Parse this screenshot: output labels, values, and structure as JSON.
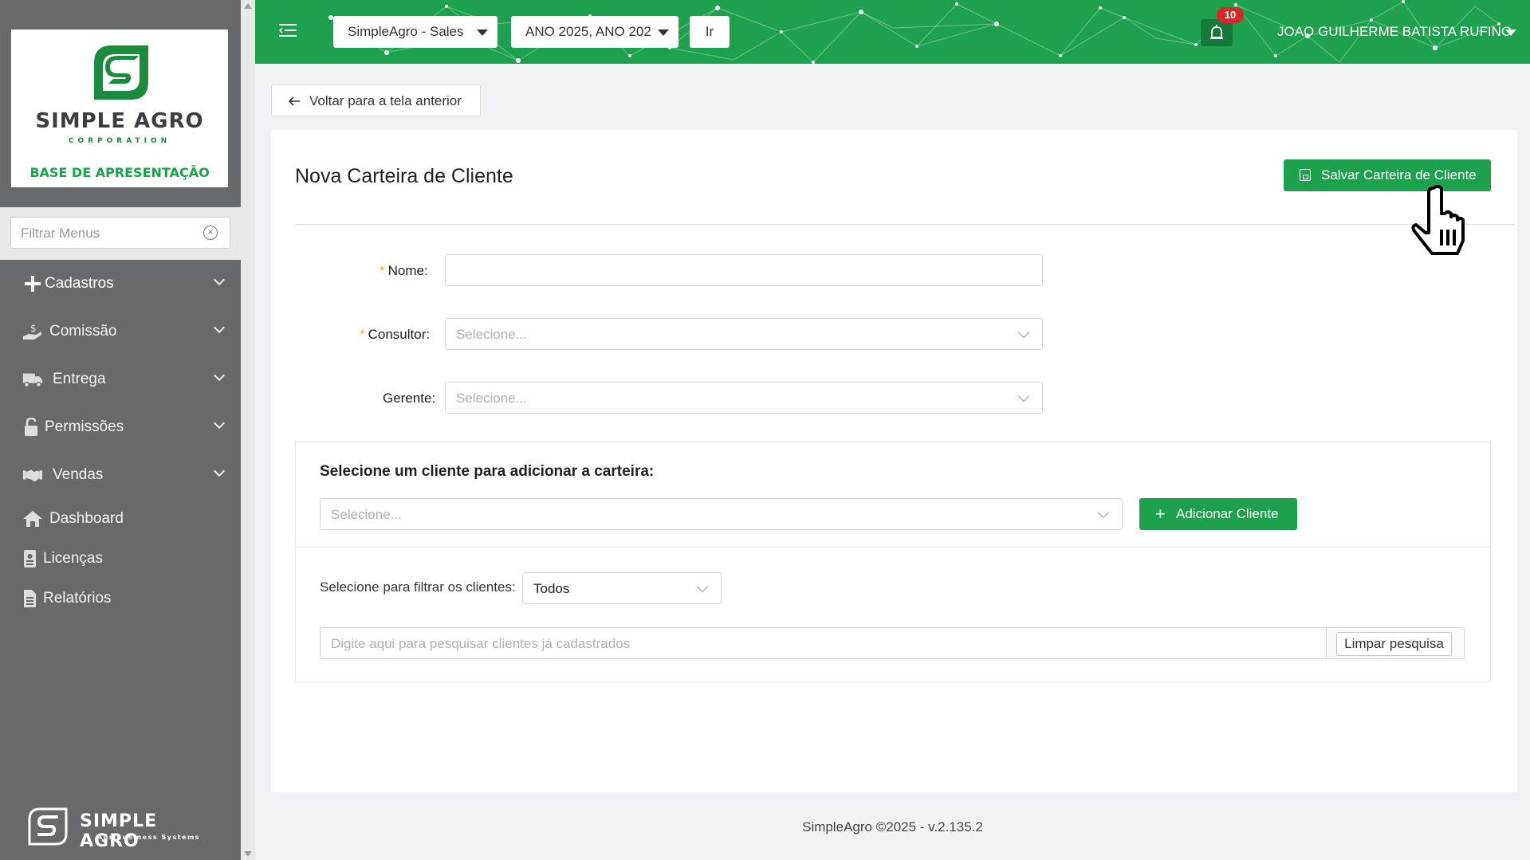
{
  "sidebar": {
    "logo": {
      "title": "SIMPLE AGRO",
      "subtitle": "CORPORATION",
      "base": "BASE DE APRESENTAÇÃO"
    },
    "filter_placeholder": "Filtrar Menus",
    "items": [
      {
        "label": "Cadastros",
        "icon": "plus-icon",
        "expandable": true
      },
      {
        "label": "Comissão",
        "icon": "hand-money-icon",
        "expandable": true
      },
      {
        "label": "Entrega",
        "icon": "truck-icon",
        "expandable": true
      },
      {
        "label": "Permissões",
        "icon": "unlock-icon",
        "expandable": true
      },
      {
        "label": "Vendas",
        "icon": "handshake-icon",
        "expandable": true
      },
      {
        "label": "Dashboard",
        "icon": "home-icon",
        "expandable": false
      },
      {
        "label": "Licenças",
        "icon": "badge-icon",
        "expandable": false
      },
      {
        "label": "Relatórios",
        "icon": "report-icon",
        "expandable": false
      }
    ],
    "footer": {
      "title": "SIMPLE AGRO",
      "subtitle": "Agribusiness Systems"
    }
  },
  "header": {
    "company_select": "SimpleAgro - Sales",
    "year_select": "ANO 2025, ANO 202",
    "go_label": "Ir",
    "notification_count": "10",
    "user_name": "JOAO GUILHERME BATISTA RUFINO",
    "brand_color": "#1ea14d"
  },
  "back_button": "Voltar para a tela anterior",
  "page": {
    "title": "Nova Carteira de Cliente",
    "save_label": "Salvar Carteira de Cliente",
    "fields": {
      "nome": {
        "label": "Nome",
        "required": true,
        "value": ""
      },
      "consultor": {
        "label": "Consultor",
        "required": true,
        "placeholder": "Selecione..."
      },
      "gerente": {
        "label": "Gerente",
        "required": false,
        "placeholder": "Selecione..."
      }
    },
    "clients": {
      "title": "Selecione um cliente para adicionar a carteira:",
      "select_placeholder": "Selecione...",
      "add_label": "Adicionar Cliente",
      "filter_label": "Selecione para filtrar os clientes:",
      "filter_value": "Todos",
      "search_placeholder": "Digite aqui para pesquisar clientes já cadastrados",
      "clear_label": "Limpar pesquisa"
    }
  },
  "footer": "SimpleAgro ©2025 - v.2.135.2"
}
